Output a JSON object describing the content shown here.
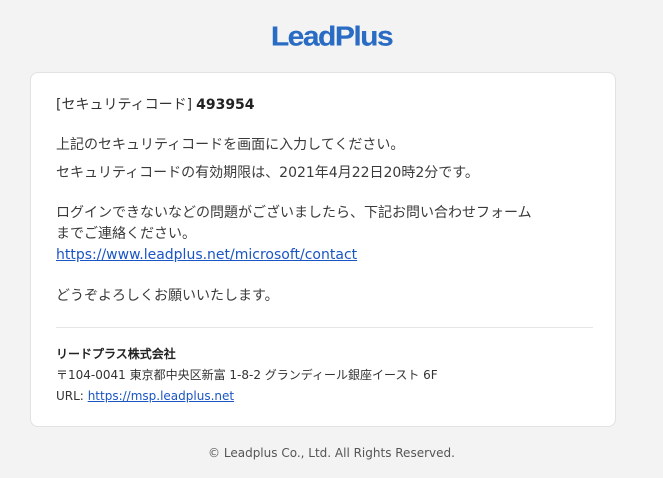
{
  "brand": {
    "logo_text": "LeadPlus",
    "accent": "#2a6cc4",
    "link_color": "#1a55c4"
  },
  "email": {
    "code_label": "[セキュリティコード]",
    "code_value": "493954",
    "line1": "上記のセキュリティコードを画面に入力してください。",
    "line2": "セキュリティコードの有効期限は、2021年4月22日20時2分です。",
    "line3": "ログインできないなどの問題がございましたら、下記お問い合わせフォーム",
    "line4": "までご連絡ください。",
    "contact_link": "https://www.leadplus.net/microsoft/contact",
    "closing": "どうぞよろしくお願いいたします。"
  },
  "signature": {
    "company": "リードプラス株式会社",
    "address": "〒104-0041 東京都中央区新富 1-8-2 グランディール銀座イースト 6F",
    "url_label": "URL:",
    "url": "https://msp.leadplus.net"
  },
  "footer": {
    "copyright": "© Leadplus Co., Ltd. All Rights Reserved."
  }
}
